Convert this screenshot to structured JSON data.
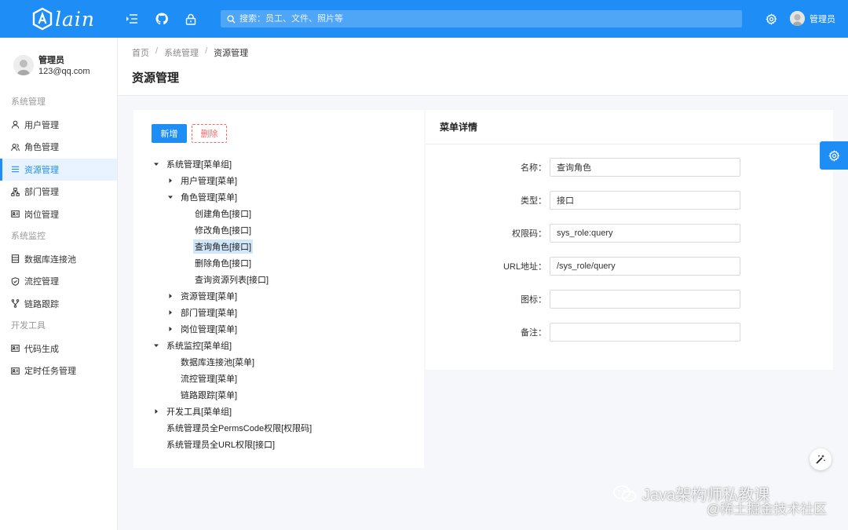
{
  "app": {
    "logo_text": "lain"
  },
  "topbar": {
    "search_placeholder": "搜索：员工、文件、照片等",
    "user_name": "管理员"
  },
  "sidebar": {
    "user": {
      "name": "管理员",
      "email": "123@qq.com"
    },
    "groups": [
      {
        "title": "系统管理",
        "items": [
          {
            "label": "用户管理",
            "icon": "user-icon"
          },
          {
            "label": "角色管理",
            "icon": "team-icon"
          },
          {
            "label": "资源管理",
            "icon": "menu-icon",
            "active": true
          },
          {
            "label": "部门管理",
            "icon": "cluster-icon"
          },
          {
            "label": "岗位管理",
            "icon": "idcard-icon"
          }
        ]
      },
      {
        "title": "系统监控",
        "items": [
          {
            "label": "数据库连接池",
            "icon": "database-icon"
          },
          {
            "label": "流控管理",
            "icon": "shield-icon"
          },
          {
            "label": "链路跟踪",
            "icon": "fork-icon"
          }
        ]
      },
      {
        "title": "开发工具",
        "items": [
          {
            "label": "代码生成",
            "icon": "code-card-icon"
          },
          {
            "label": "定时任务管理",
            "icon": "schedule-card-icon"
          }
        ]
      }
    ]
  },
  "breadcrumb": [
    "首页",
    "系统管理",
    "资源管理"
  ],
  "page_title": "资源管理",
  "toolbar": {
    "add_label": "新增",
    "delete_label": "删除"
  },
  "tree": [
    {
      "label": "系统管理[菜单组]",
      "level": 0,
      "toggle": "open"
    },
    {
      "label": "用户管理[菜单]",
      "level": 1,
      "toggle": "closed"
    },
    {
      "label": "角色管理[菜单]",
      "level": 1,
      "toggle": "open"
    },
    {
      "label": "创建角色[接口]",
      "level": 2,
      "toggle": "none"
    },
    {
      "label": "修改角色[接口]",
      "level": 2,
      "toggle": "none"
    },
    {
      "label": "查询角色[接口]",
      "level": 2,
      "toggle": "none",
      "selected": true
    },
    {
      "label": "删除角色[接口]",
      "level": 2,
      "toggle": "none"
    },
    {
      "label": "查询资源列表[接口]",
      "level": 2,
      "toggle": "none"
    },
    {
      "label": "资源管理[菜单]",
      "level": 1,
      "toggle": "closed"
    },
    {
      "label": "部门管理[菜单]",
      "level": 1,
      "toggle": "closed"
    },
    {
      "label": "岗位管理[菜单]",
      "level": 1,
      "toggle": "closed"
    },
    {
      "label": "系统监控[菜单组]",
      "level": 0,
      "toggle": "open"
    },
    {
      "label": "数据库连接池[菜单]",
      "level": 1,
      "toggle": "none"
    },
    {
      "label": "流控管理[菜单]",
      "level": 1,
      "toggle": "none"
    },
    {
      "label": "链路跟踪[菜单]",
      "level": 1,
      "toggle": "none"
    },
    {
      "label": "开发工具[菜单组]",
      "level": 0,
      "toggle": "closed"
    },
    {
      "label": "系统管理员全PermsCode权限[权限码]",
      "level": 0,
      "toggle": "none"
    },
    {
      "label": "系统管理员全URL权限[接口]",
      "level": 0,
      "toggle": "none"
    }
  ],
  "detail": {
    "title": "菜单详情",
    "fields": [
      {
        "label": "名称：",
        "value": "查询角色"
      },
      {
        "label": "类型：",
        "value": "接口"
      },
      {
        "label": "权限码：",
        "value": "sys_role:query"
      },
      {
        "label": "URL地址：",
        "value": "/sys_role/query"
      },
      {
        "label": "图标：",
        "value": ""
      },
      {
        "label": "备注：",
        "value": ""
      }
    ]
  },
  "watermark": {
    "line1": "Java架构师私教课",
    "line2": "@稀土掘金技术社区"
  },
  "colors": {
    "primary": "#1e8df5",
    "danger": "#f06a6a",
    "selected_bg": "#cfe6fb"
  }
}
